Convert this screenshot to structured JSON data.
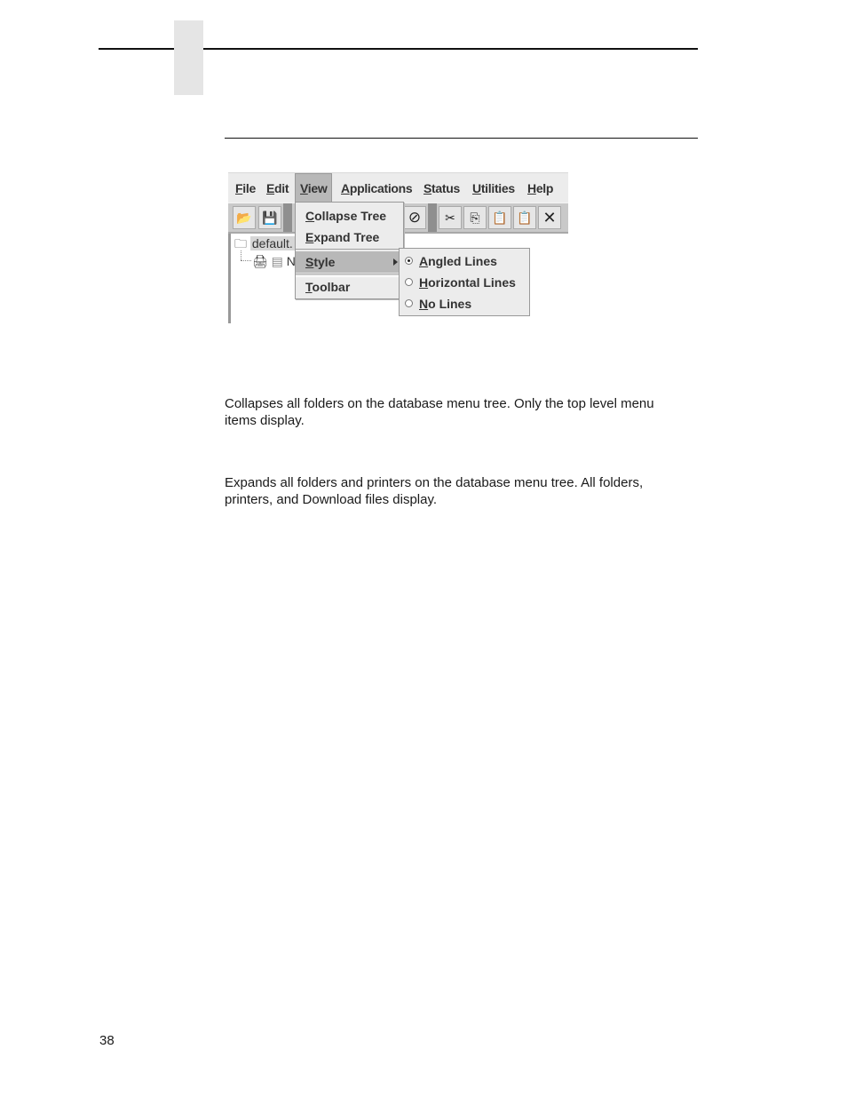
{
  "page": {
    "page_number": "38"
  },
  "screenshot": {
    "menubar": {
      "items": [
        {
          "label": "File",
          "mnemonic": "F",
          "rest": "ile"
        },
        {
          "label": "Edit",
          "mnemonic": "E",
          "rest": "dit"
        },
        {
          "label": "View",
          "mnemonic": "V",
          "rest": "iew",
          "active": true
        },
        {
          "label": "Applications",
          "mnemonic": "A",
          "rest": "pplications"
        },
        {
          "label": "Status",
          "mnemonic": "S",
          "rest": "tatus"
        },
        {
          "label": "Utilities",
          "mnemonic": "U",
          "rest": "tilities"
        },
        {
          "label": "Help",
          "mnemonic": "H",
          "rest": "elp"
        }
      ]
    },
    "toolbar": {
      "buttons": [
        {
          "icon": "open-folder-icon",
          "glyph": "📂"
        },
        {
          "icon": "save-icon",
          "glyph": "💾"
        },
        {
          "icon": "stop-icon",
          "glyph": "⊘"
        },
        {
          "icon": "cut-icon",
          "glyph": "✂"
        },
        {
          "icon": "copy-icon",
          "glyph": "⎘"
        },
        {
          "icon": "paste-icon",
          "glyph": "📋"
        },
        {
          "icon": "paste-special-icon",
          "glyph": "📋"
        },
        {
          "icon": "delete-icon",
          "glyph": "✕"
        }
      ]
    },
    "tree": {
      "root_label": "default.",
      "child_label": "N"
    },
    "view_menu": {
      "items": [
        {
          "mnemonic": "C",
          "rest": "ollapse Tree"
        },
        {
          "mnemonic": "E",
          "rest": "xpand Tree"
        },
        {
          "mnemonic": "S",
          "rest": "tyle",
          "has_submenu": true,
          "highlighted": true
        },
        {
          "mnemonic": "T",
          "rest": "oolbar"
        }
      ]
    },
    "style_submenu": {
      "items": [
        {
          "mnemonic": "A",
          "rest": "ngled Lines",
          "selected": true
        },
        {
          "mnemonic": "H",
          "rest": "orizontal Lines",
          "selected": false
        },
        {
          "mnemonic": "N",
          "rest": "o Lines",
          "selected": false
        }
      ]
    }
  },
  "body": {
    "collapse_description": "Collapses all folders on the database menu tree. Only the top level menu items display.",
    "expand_description": "Expands all folders and printers on the database menu tree. All folders, printers, and Download files display."
  }
}
